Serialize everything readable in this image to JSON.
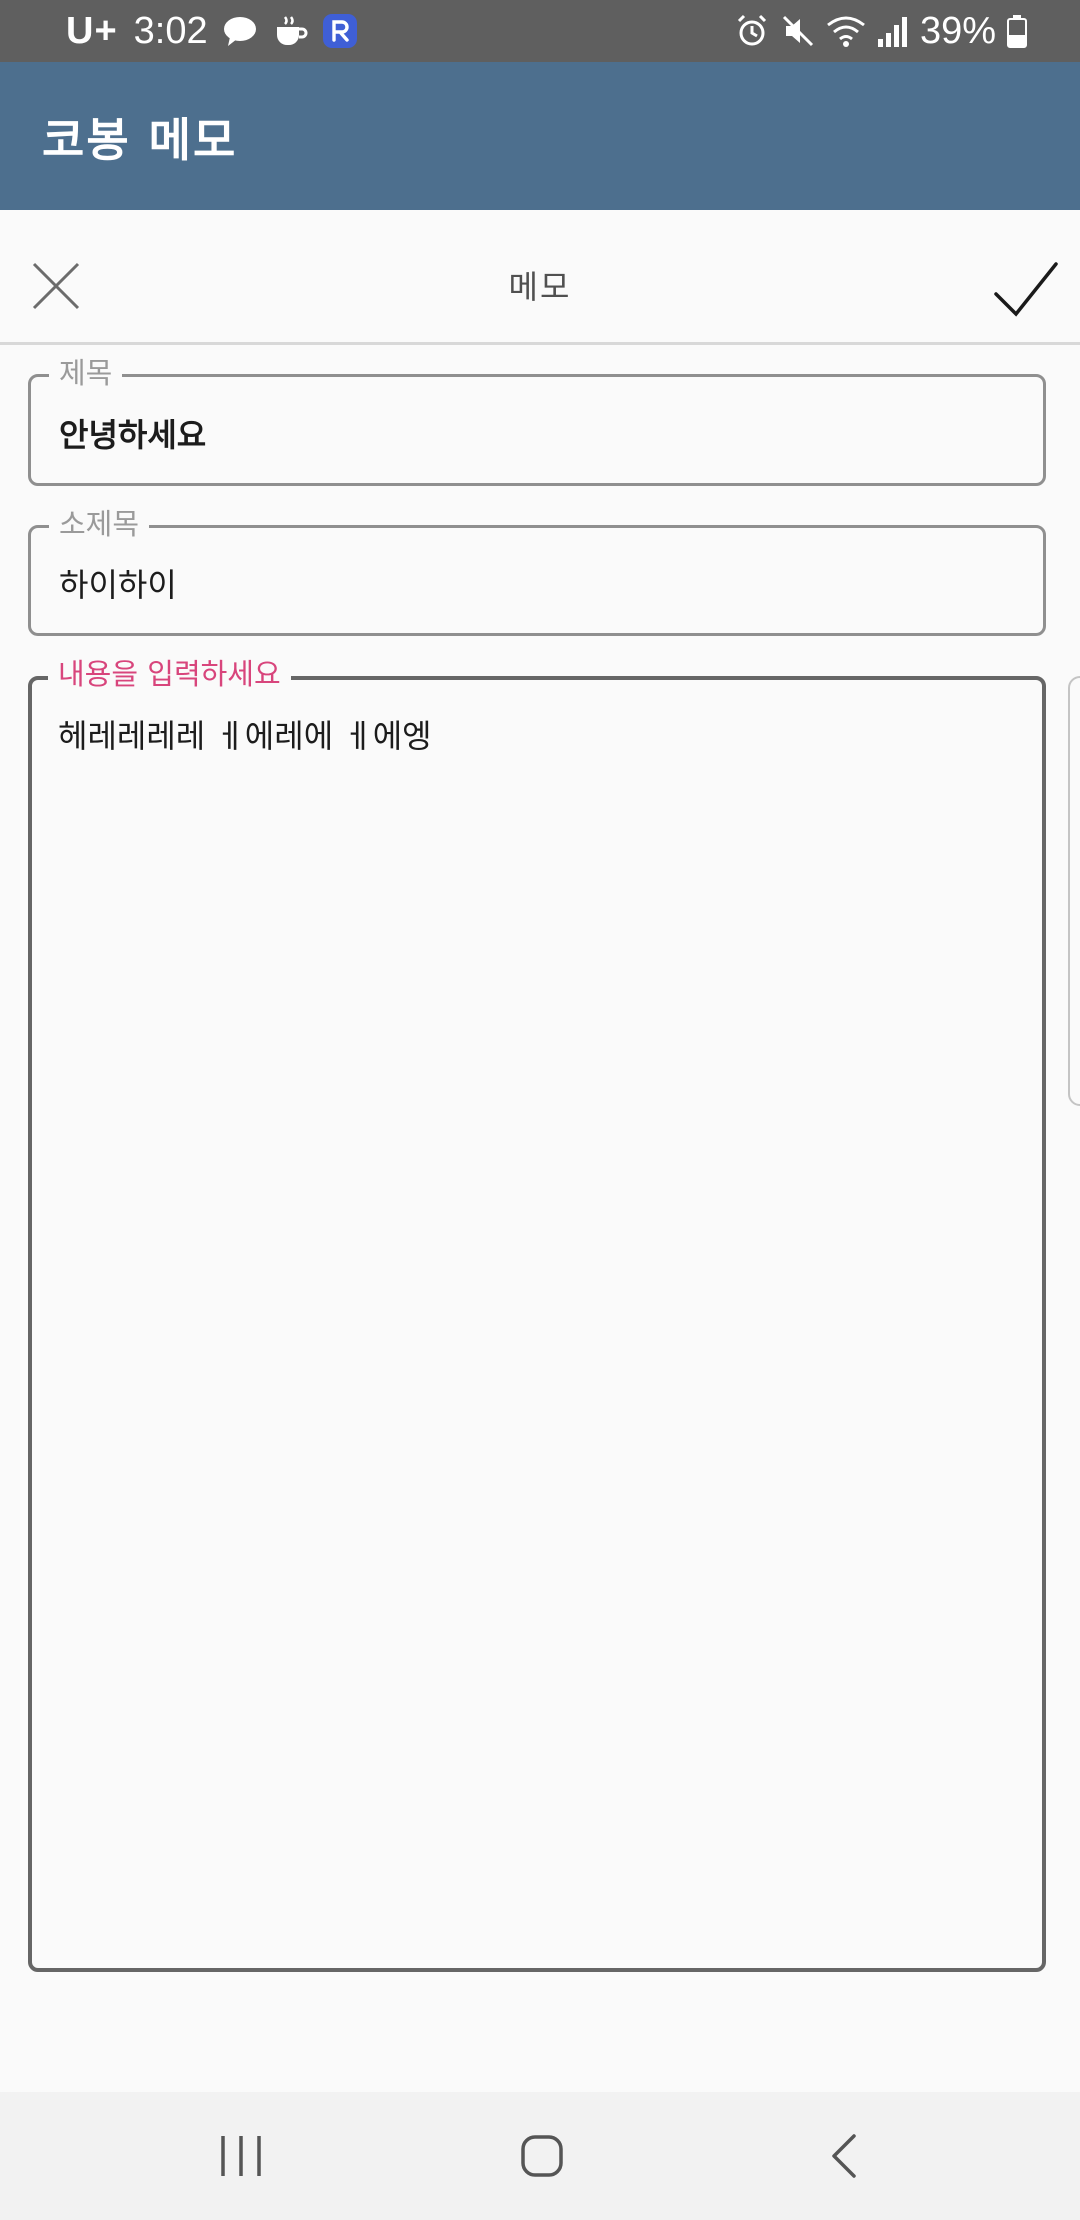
{
  "status_bar": {
    "carrier": "U+",
    "time": "3:02",
    "battery": "39%"
  },
  "app_bar": {
    "title": "코봉 메모"
  },
  "toolbar": {
    "title": "메모"
  },
  "form": {
    "title_label": "제목",
    "title_value": "안녕하세요",
    "subtitle_label": "소제목",
    "subtitle_value": "하이하이",
    "body_label": "내용을 입력하세요",
    "body_value": "헤레레레레 ㅔ에레에 ㅔ에엥"
  },
  "icons": {
    "close": "close-icon",
    "confirm": "check-icon",
    "recents": "recents-icon",
    "home": "home-icon",
    "back": "back-icon"
  },
  "colors": {
    "app_bar": "#4d6f8e",
    "status_bar": "#5f5f5f",
    "accent_label": "#d8457c"
  }
}
